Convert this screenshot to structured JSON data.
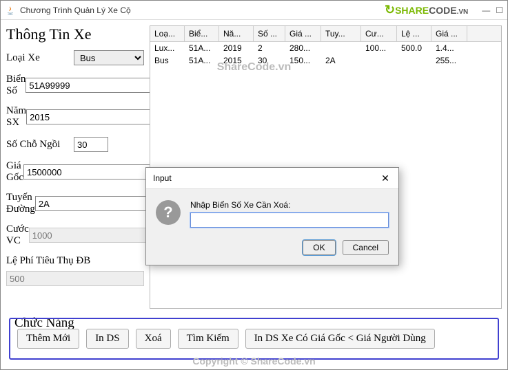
{
  "window": {
    "title": "Chương Trình Quản Lý Xe Cộ"
  },
  "logo": {
    "pre": "SHARE",
    "post": "CODE",
    "suf": ".VN"
  },
  "watermarks": {
    "mid": "ShareCode.vn",
    "bottom": "Copyright © ShareCode.vn"
  },
  "form": {
    "title": "Thông Tin Xe",
    "loai_label": "Loại Xe",
    "loai_value": "Bus",
    "bien_label": "Biển Số",
    "bien_value": "51A99999",
    "nam_label": "Năm SX",
    "nam_value": "2015",
    "socho_label": "Số Chỗ Ngồi",
    "socho_value": "30",
    "gia_label": "Giá Gốc",
    "gia_value": "1500000",
    "tuyen_label": "Tuyến Đường",
    "tuyen_value": "2A",
    "cuoc_label": "Cước VC",
    "cuoc_value": "1000",
    "lephi_label": "Lệ Phí Tiêu Thụ ĐB",
    "lephi_value": "500"
  },
  "chuc_nang": "Chức Năng",
  "buttons": {
    "them": "Thêm Mới",
    "inds": "In DS",
    "xoa": "Xoá",
    "tim": "Tìm Kiếm",
    "inds2": "In DS Xe Có Giá Gốc < Giá Người Dùng"
  },
  "table": {
    "headers": [
      "Loạ...",
      "Biể...",
      "Nă...",
      "Số ...",
      "Giá ...",
      "Tuy...",
      "Cư...",
      "Lệ ...",
      "Giá ..."
    ],
    "rows": [
      [
        "Lux...",
        "51A...",
        "2019",
        "2",
        "280...",
        "",
        "100...",
        "500.0",
        "1.4..."
      ],
      [
        "Bus",
        "51A...",
        "2015",
        "30",
        "150...",
        "2A",
        "",
        "",
        "255..."
      ]
    ]
  },
  "dialog": {
    "title": "Input",
    "label": "Nhập Biển Số Xe Cần Xoá:",
    "ok": "OK",
    "cancel": "Cancel",
    "value": ""
  }
}
